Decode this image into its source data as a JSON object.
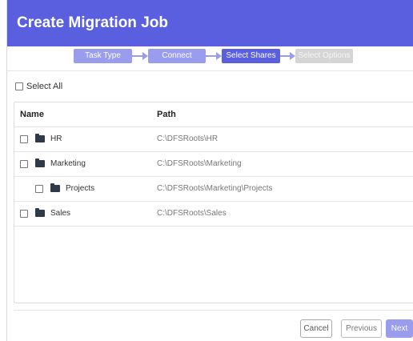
{
  "dialog": {
    "title": "Create Migration Job"
  },
  "steps": [
    {
      "label": "Task Type",
      "state": "done"
    },
    {
      "label": "Connect",
      "state": "done"
    },
    {
      "label": "Select Shares",
      "state": "active"
    },
    {
      "label": "Select Options",
      "state": "pending"
    }
  ],
  "select_all": {
    "label": "Select All",
    "checked": false
  },
  "table": {
    "headers": {
      "name": "Name",
      "path": "Path"
    },
    "rows": [
      {
        "name": "HR",
        "path": "C:\\DFSRoots\\HR",
        "level": 0,
        "icon": "folder-icon",
        "checked": false
      },
      {
        "name": "Marketing",
        "path": "C:\\DFSRoots\\Marketing",
        "level": 0,
        "icon": "folder-icon",
        "checked": false
      },
      {
        "name": "Projects",
        "path": "C:\\DFSRoots\\Marketing\\Projects",
        "level": 1,
        "icon": "folder-icon",
        "checked": false
      },
      {
        "name": "Sales",
        "path": "C:\\DFSRoots\\Sales",
        "level": 0,
        "icon": "folder-icon",
        "checked": false
      }
    ]
  },
  "buttons": {
    "cancel": "Cancel",
    "previous": "Previous",
    "next": "Next"
  },
  "colors": {
    "header_bg": "#5a5fe0",
    "step_done": "#9a9cee",
    "step_pending": "#d5d5d5",
    "folder": "#2f3a48"
  }
}
